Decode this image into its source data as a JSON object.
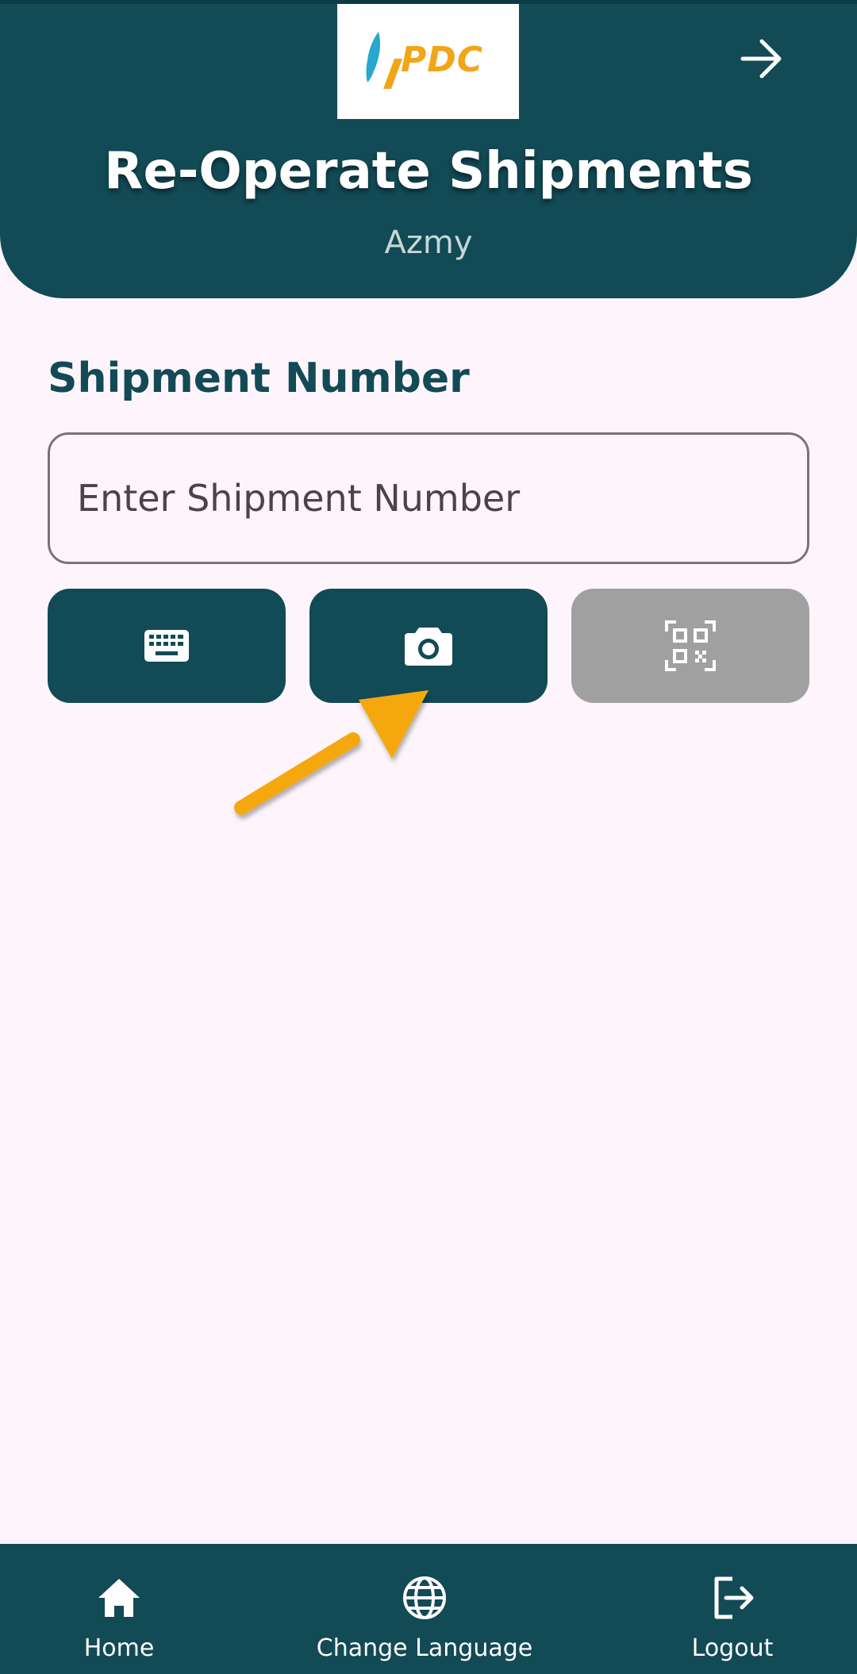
{
  "header": {
    "logo_text": "PDC",
    "title": "Re-Operate Shipments",
    "user": "Azmy",
    "forward_icon": "arrow-right-icon"
  },
  "form": {
    "label": "Shipment Number",
    "placeholder": "Enter Shipment Number",
    "value": ""
  },
  "actions": [
    {
      "icon": "keyboard-icon",
      "enabled": true
    },
    {
      "icon": "camera-icon",
      "enabled": true
    },
    {
      "icon": "qr-code-icon",
      "enabled": false
    }
  ],
  "annotation": {
    "icon": "pointer-arrow-icon",
    "color": "#f5a80f"
  },
  "bottom_nav": {
    "items": [
      {
        "label": "Home",
        "icon": "home-icon"
      },
      {
        "label": "Change Language",
        "icon": "globe-icon"
      },
      {
        "label": "Logout",
        "icon": "logout-icon"
      }
    ]
  },
  "colors": {
    "primary": "#124a55",
    "background": "#fdf5fb",
    "disabled": "#a0a0a0",
    "brand_orange": "#f2a519",
    "brand_blue": "#29a7cc"
  }
}
